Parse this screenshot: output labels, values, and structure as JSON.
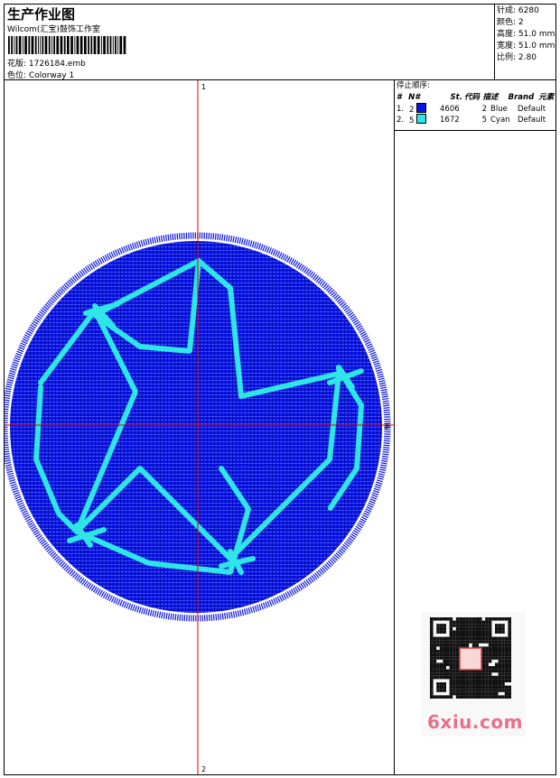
{
  "header": {
    "title": "生产作业图",
    "company": "Wilcom(汇宝)鼓饰工作室",
    "design_label": "花版:",
    "design_file": "1726184.emb",
    "colorway_label": "色位:",
    "colorway": "Colorway 1"
  },
  "stats": {
    "stitches_label": "针成:",
    "stitches": "6280",
    "colors_label": "颜色:",
    "colors": "2",
    "height_label": "高度:",
    "height": "51.0 mm",
    "width_label": "宽度:",
    "width": "51.0 mm",
    "ratio_label": "比例:",
    "ratio": "2.80"
  },
  "stop_sequence": {
    "title": "停止顺序:",
    "columns": [
      "#",
      "N#",
      "St.",
      "代码",
      "描述",
      "Brand",
      "元素"
    ],
    "rows": [
      {
        "num": "1.",
        "needle": "2",
        "stitches": "4606",
        "code": "2",
        "desc": "Blue",
        "brand": "Default",
        "color": "#0a14e6"
      },
      {
        "num": "2.",
        "needle": "5",
        "stitches": "1672",
        "code": "5",
        "desc": "Cyan",
        "brand": "Default",
        "color": "#2ee6e6"
      }
    ]
  },
  "canvas": {
    "marker_top": "1",
    "marker_bottom": "2",
    "marker_right": "3",
    "circle_color": "#0a14e6",
    "anchor_color": "#2ee6e6",
    "crosshair_color": "#e00000"
  },
  "watermark": {
    "site": "6xiu.com",
    "seal": "汉圆图"
  }
}
